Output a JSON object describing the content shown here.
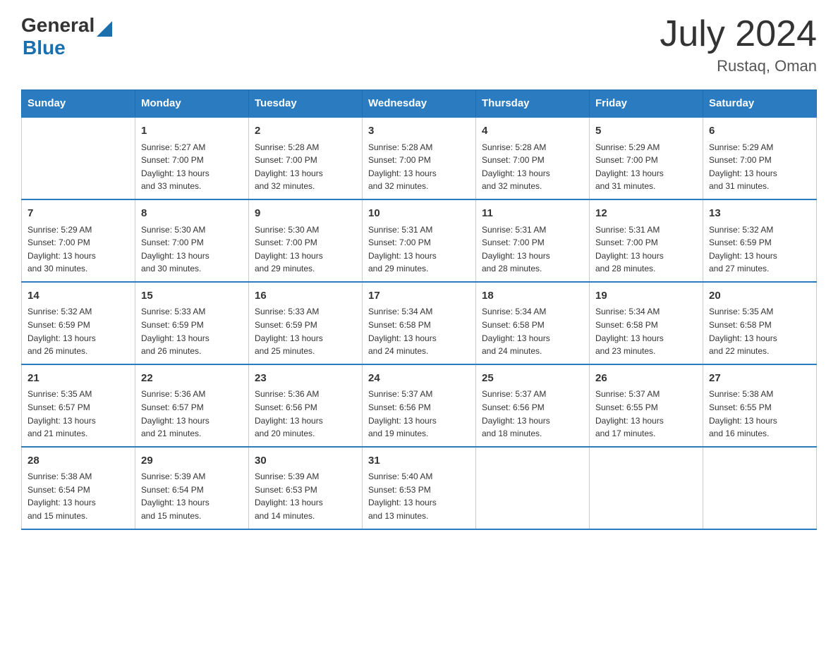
{
  "header": {
    "logo_general": "General",
    "logo_blue": "Blue",
    "month_year": "July 2024",
    "location": "Rustaq, Oman"
  },
  "calendar": {
    "days_of_week": [
      "Sunday",
      "Monday",
      "Tuesday",
      "Wednesday",
      "Thursday",
      "Friday",
      "Saturday"
    ],
    "weeks": [
      [
        {
          "day": "",
          "info": ""
        },
        {
          "day": "1",
          "info": "Sunrise: 5:27 AM\nSunset: 7:00 PM\nDaylight: 13 hours\nand 33 minutes."
        },
        {
          "day": "2",
          "info": "Sunrise: 5:28 AM\nSunset: 7:00 PM\nDaylight: 13 hours\nand 32 minutes."
        },
        {
          "day": "3",
          "info": "Sunrise: 5:28 AM\nSunset: 7:00 PM\nDaylight: 13 hours\nand 32 minutes."
        },
        {
          "day": "4",
          "info": "Sunrise: 5:28 AM\nSunset: 7:00 PM\nDaylight: 13 hours\nand 32 minutes."
        },
        {
          "day": "5",
          "info": "Sunrise: 5:29 AM\nSunset: 7:00 PM\nDaylight: 13 hours\nand 31 minutes."
        },
        {
          "day": "6",
          "info": "Sunrise: 5:29 AM\nSunset: 7:00 PM\nDaylight: 13 hours\nand 31 minutes."
        }
      ],
      [
        {
          "day": "7",
          "info": "Sunrise: 5:29 AM\nSunset: 7:00 PM\nDaylight: 13 hours\nand 30 minutes."
        },
        {
          "day": "8",
          "info": "Sunrise: 5:30 AM\nSunset: 7:00 PM\nDaylight: 13 hours\nand 30 minutes."
        },
        {
          "day": "9",
          "info": "Sunrise: 5:30 AM\nSunset: 7:00 PM\nDaylight: 13 hours\nand 29 minutes."
        },
        {
          "day": "10",
          "info": "Sunrise: 5:31 AM\nSunset: 7:00 PM\nDaylight: 13 hours\nand 29 minutes."
        },
        {
          "day": "11",
          "info": "Sunrise: 5:31 AM\nSunset: 7:00 PM\nDaylight: 13 hours\nand 28 minutes."
        },
        {
          "day": "12",
          "info": "Sunrise: 5:31 AM\nSunset: 7:00 PM\nDaylight: 13 hours\nand 28 minutes."
        },
        {
          "day": "13",
          "info": "Sunrise: 5:32 AM\nSunset: 6:59 PM\nDaylight: 13 hours\nand 27 minutes."
        }
      ],
      [
        {
          "day": "14",
          "info": "Sunrise: 5:32 AM\nSunset: 6:59 PM\nDaylight: 13 hours\nand 26 minutes."
        },
        {
          "day": "15",
          "info": "Sunrise: 5:33 AM\nSunset: 6:59 PM\nDaylight: 13 hours\nand 26 minutes."
        },
        {
          "day": "16",
          "info": "Sunrise: 5:33 AM\nSunset: 6:59 PM\nDaylight: 13 hours\nand 25 minutes."
        },
        {
          "day": "17",
          "info": "Sunrise: 5:34 AM\nSunset: 6:58 PM\nDaylight: 13 hours\nand 24 minutes."
        },
        {
          "day": "18",
          "info": "Sunrise: 5:34 AM\nSunset: 6:58 PM\nDaylight: 13 hours\nand 24 minutes."
        },
        {
          "day": "19",
          "info": "Sunrise: 5:34 AM\nSunset: 6:58 PM\nDaylight: 13 hours\nand 23 minutes."
        },
        {
          "day": "20",
          "info": "Sunrise: 5:35 AM\nSunset: 6:58 PM\nDaylight: 13 hours\nand 22 minutes."
        }
      ],
      [
        {
          "day": "21",
          "info": "Sunrise: 5:35 AM\nSunset: 6:57 PM\nDaylight: 13 hours\nand 21 minutes."
        },
        {
          "day": "22",
          "info": "Sunrise: 5:36 AM\nSunset: 6:57 PM\nDaylight: 13 hours\nand 21 minutes."
        },
        {
          "day": "23",
          "info": "Sunrise: 5:36 AM\nSunset: 6:56 PM\nDaylight: 13 hours\nand 20 minutes."
        },
        {
          "day": "24",
          "info": "Sunrise: 5:37 AM\nSunset: 6:56 PM\nDaylight: 13 hours\nand 19 minutes."
        },
        {
          "day": "25",
          "info": "Sunrise: 5:37 AM\nSunset: 6:56 PM\nDaylight: 13 hours\nand 18 minutes."
        },
        {
          "day": "26",
          "info": "Sunrise: 5:37 AM\nSunset: 6:55 PM\nDaylight: 13 hours\nand 17 minutes."
        },
        {
          "day": "27",
          "info": "Sunrise: 5:38 AM\nSunset: 6:55 PM\nDaylight: 13 hours\nand 16 minutes."
        }
      ],
      [
        {
          "day": "28",
          "info": "Sunrise: 5:38 AM\nSunset: 6:54 PM\nDaylight: 13 hours\nand 15 minutes."
        },
        {
          "day": "29",
          "info": "Sunrise: 5:39 AM\nSunset: 6:54 PM\nDaylight: 13 hours\nand 15 minutes."
        },
        {
          "day": "30",
          "info": "Sunrise: 5:39 AM\nSunset: 6:53 PM\nDaylight: 13 hours\nand 14 minutes."
        },
        {
          "day": "31",
          "info": "Sunrise: 5:40 AM\nSunset: 6:53 PM\nDaylight: 13 hours\nand 13 minutes."
        },
        {
          "day": "",
          "info": ""
        },
        {
          "day": "",
          "info": ""
        },
        {
          "day": "",
          "info": ""
        }
      ]
    ]
  }
}
